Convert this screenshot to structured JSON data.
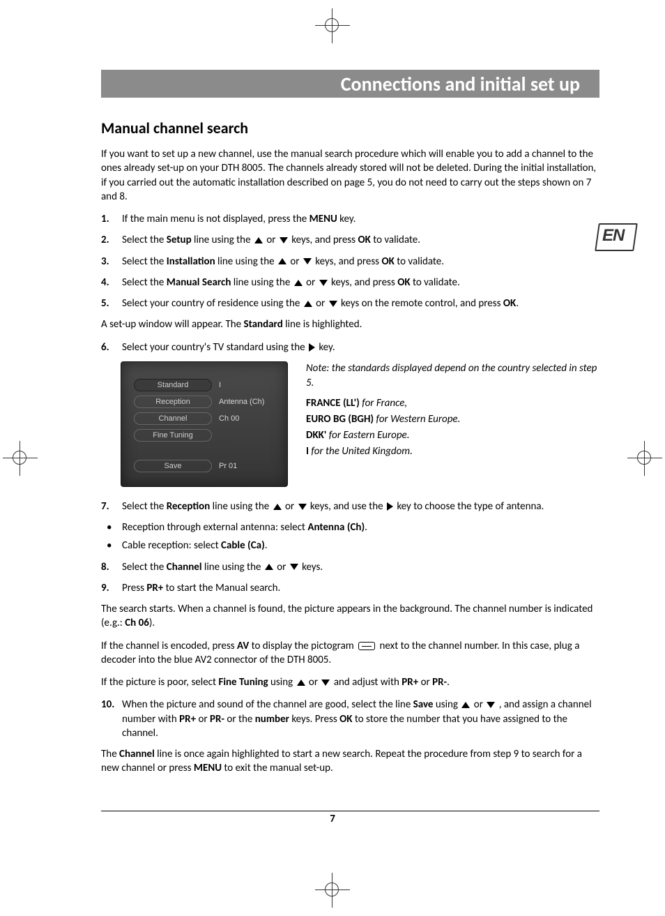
{
  "header": {
    "title": "Connections and initial set up"
  },
  "lang_badge": "EN",
  "section_title": "Manual channel search",
  "intro": "If you want to set up a new channel, use the manual search procedure which will enable you to add a channel to the ones already set-up on your DTH 8005. The channels already stored will not be deleted. During the initial installation, if you carried out the automatic installation described on page 5, you do not need to carry out the steps shown on 7 and 8.",
  "steps": {
    "s1": {
      "num": "1.",
      "a": "If the main menu is not displayed, press the ",
      "b": "MENU",
      "c": " key."
    },
    "s2": {
      "num": "2.",
      "a": "Select the ",
      "b": "Setup",
      "c": " line using the ",
      "d": " or ",
      "e": " keys, and press ",
      "f": "OK",
      "g": " to validate."
    },
    "s3": {
      "num": "3.",
      "a": "Select the ",
      "b": "Installation",
      "c": " line using the ",
      "d": " or ",
      "e": " keys, and press ",
      "f": "OK",
      "g": " to validate."
    },
    "s4": {
      "num": "4.",
      "a": "Select the ",
      "b": "Manual Search",
      "c": " line using the ",
      "d": " or ",
      "e": " keys, and press ",
      "f": "OK",
      "g": " to validate."
    },
    "s5": {
      "num": "5.",
      "a": "Select your country of residence using the ",
      "b": " or ",
      "c": " keys on the remote control, and press ",
      "d": "OK",
      "e": "."
    },
    "between5_6": {
      "a": "A set-up window will appear. The ",
      "b": "Standard",
      "c": " line is highlighted."
    },
    "s6": {
      "num": "6.",
      "a": "Select your country's TV standard using the ",
      "b": " key."
    },
    "s7": {
      "num": "7.",
      "a": "Select the ",
      "b": "Reception",
      "c": " line using the ",
      "d": " or ",
      "e": " keys, and use the ",
      "f": " key to choose the type of antenna."
    },
    "s7sub": {
      "a1": "Reception through external antenna: select ",
      "a2": "Antenna (Ch)",
      "a3": ".",
      "b1": "Cable reception: select ",
      "b2": "Cable (Ca)",
      "b3": "."
    },
    "s8": {
      "num": "8.",
      "a": "Select the ",
      "b": "Channel",
      "c": " line using the ",
      "d": " or ",
      "e": " keys."
    },
    "s9": {
      "num": "9.",
      "a": "Press ",
      "b": "PR+",
      "c": " to start the Manual search."
    },
    "after9a": {
      "a": "The search starts. When a channel is found, the picture appears in the background. The channel number is indicated (e.g.: ",
      "b": "Ch 06",
      "c": ")."
    },
    "after9b": {
      "a": "If the channel is encoded, press ",
      "b": "AV",
      "c": " to display the pictogram ",
      "d": " next to the channel number. In this case, plug a decoder into the blue AV2 connector of the DTH 8005."
    },
    "after9c": {
      "a": "If the picture is poor, select ",
      "b": "Fine Tuning",
      "c": " using ",
      "d": " or ",
      "e": " and adjust with ",
      "f": "PR+",
      "g": " or ",
      "h": "PR-",
      "i": "."
    },
    "s10": {
      "num": "10.",
      "a": "When the picture and sound of the channel are good, select the line ",
      "b": "Save",
      "c": " using ",
      "d": " or ",
      "e": " , and assign a channel number with ",
      "f": "PR+",
      "g": " or ",
      "h": "PR-",
      "i": " or the ",
      "j": "number",
      "k": " keys. Press ",
      "l": "OK",
      "m": " to store the number that you have assigned to the channel."
    },
    "closing": {
      "a": "The ",
      "b": "Channel",
      "c": " line is once again highlighted to start a new search. Repeat the procedure from step 9 to search for a new channel or press ",
      "d": "MENU",
      "e": " to exit the manual set-up."
    }
  },
  "screenshot": {
    "rows": [
      {
        "label": "Standard",
        "value": "I"
      },
      {
        "label": "Reception",
        "value": "Antenna (Ch)"
      },
      {
        "label": "Channel",
        "value": "Ch 00"
      },
      {
        "label": "Fine Tuning",
        "value": ""
      }
    ],
    "save": {
      "label": "Save",
      "value": "Pr  01"
    }
  },
  "notes": {
    "intro": "Note: the standards displayed depend on the country selected in step 5.",
    "lines": [
      {
        "b": "FRANCE (LL')",
        "i": " for France,"
      },
      {
        "b": "EURO BG (BGH)",
        "i": " for Western Europe."
      },
      {
        "b": "DKK'",
        "i": " for Eastern Europe."
      },
      {
        "b": "I",
        "i": " for the United Kingdom."
      }
    ]
  },
  "page_number": "7"
}
